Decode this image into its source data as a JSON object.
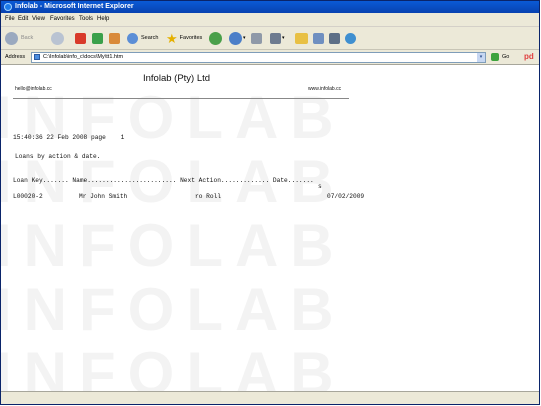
{
  "window": {
    "title": "Infolab - Microsoft Internet Explorer"
  },
  "menu": {
    "file": "File",
    "edit": "Edit",
    "view": "View",
    "favorites": "Favorites",
    "tools": "Tools",
    "help": "Help"
  },
  "toolbar": {
    "back": "Back",
    "search": "Search",
    "favorites": "Favorites"
  },
  "address": {
    "label": "Address",
    "url": "C:\\Infolab\\info_c\\docs\\My\\tt1.htm",
    "go": "Go",
    "brand": "pd"
  },
  "document": {
    "watermark": "INFOLAB",
    "company": "Infolab (Pty) Ltd",
    "email": "hello@infolab.cc",
    "website": "www.infolab.cc",
    "timestamp": "15:40:36 22 Feb 2008 page    1",
    "report_title": "Loans by action & date.",
    "columns_line": "Loan Key....... Name........................ Next Action............. Date.......",
    "columns_wrap": "s",
    "row": {
      "loan_key": "L00020-2",
      "name": "Mr John Smith",
      "next_action": "ro Roll",
      "date": "07/02/2009"
    }
  }
}
